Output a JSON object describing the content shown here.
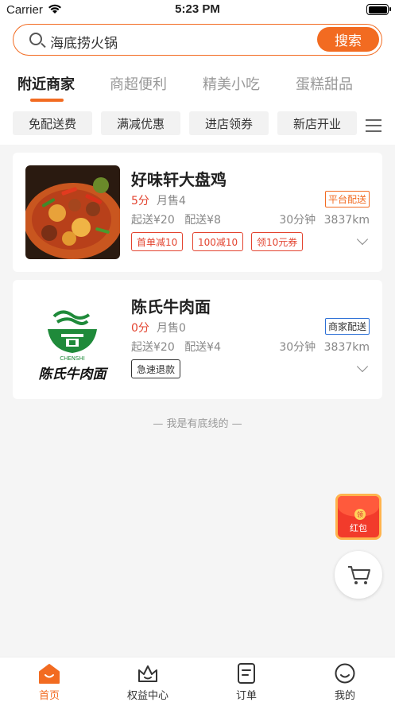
{
  "status_bar": {
    "carrier": "Carrier",
    "time": "5:23 PM"
  },
  "search": {
    "query": "海底捞火锅",
    "button_label": "搜索"
  },
  "category_tabs": [
    "附近商家",
    "商超便利",
    "精美小吃",
    "蛋糕甜品"
  ],
  "active_tab": "附近商家",
  "filter_chips": [
    "免配送费",
    "满减优惠",
    "进店领券",
    "新店开业"
  ],
  "shops": [
    {
      "name": "好味轩大盘鸡",
      "rating": "5分",
      "sales": "月售4",
      "delivery_type": "平台配送",
      "min_order": "起送¥20",
      "delivery_fee": "配送¥8",
      "eta": "30分钟",
      "distance": "3837km",
      "promos": [
        "首单减10",
        "100减10",
        "领10元券"
      ]
    },
    {
      "name": "陈氏牛肉面",
      "rating": "0分",
      "sales": "月售0",
      "delivery_type": "商家配送",
      "min_order": "起送¥20",
      "delivery_fee": "配送¥4",
      "eta": "30分钟",
      "distance": "3837km",
      "tags": [
        "急速退款"
      ],
      "logo_text": "陈氏牛肉面",
      "logo_subtext": "CHENSHI"
    }
  ],
  "list_end_note": "— 我是有底线的 —",
  "red_packet": {
    "label": "红包",
    "coin": "领"
  },
  "tab_bar": [
    {
      "label": "首页",
      "icon": "home-icon",
      "active": true
    },
    {
      "label": "权益中心",
      "icon": "crown-icon",
      "active": false
    },
    {
      "label": "订单",
      "icon": "order-icon",
      "active": false
    },
    {
      "label": "我的",
      "icon": "profile-icon",
      "active": false
    }
  ],
  "colors": {
    "accent": "#f26b21",
    "red": "#e3432f",
    "blue": "#2c6fd6"
  }
}
